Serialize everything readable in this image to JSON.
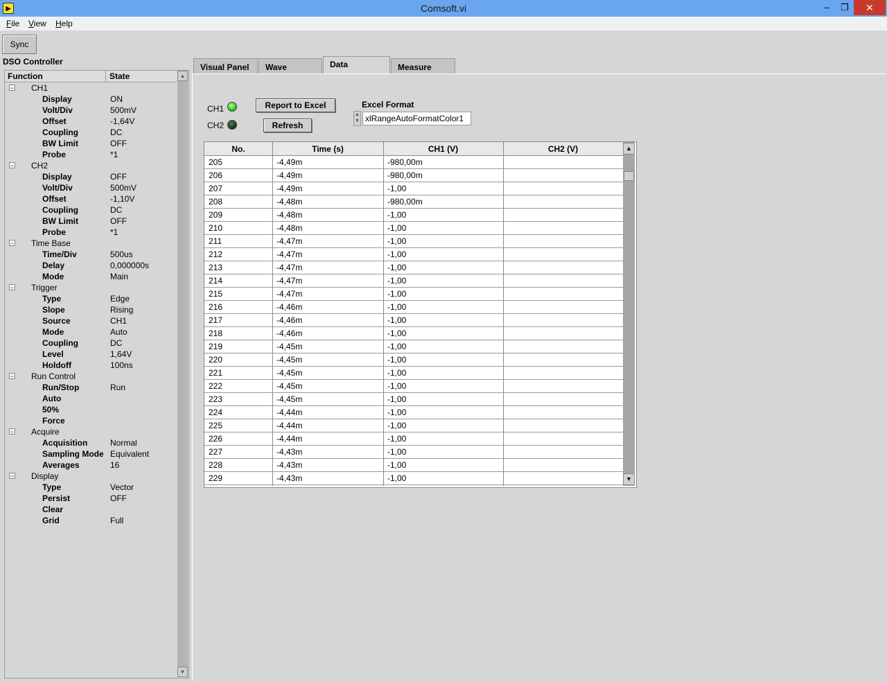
{
  "window": {
    "title": "Comsoft.vi",
    "min": "–",
    "max": "❐",
    "close": "✕"
  },
  "menu": [
    {
      "label": "File",
      "accel": "F",
      "rest": "ile"
    },
    {
      "label": "View",
      "accel": "V",
      "rest": "iew"
    },
    {
      "label": "Help",
      "accel": "H",
      "rest": "elp"
    }
  ],
  "toolbar": {
    "sync_label": "Sync"
  },
  "controller": {
    "title": "DSO Controller",
    "col_function": "Function",
    "col_state": "State",
    "groups": [
      {
        "label": "CH1",
        "children": [
          {
            "label": "Display",
            "value": "ON"
          },
          {
            "label": "Volt/Div",
            "value": "500mV"
          },
          {
            "label": "Offset",
            "value": "-1,64V"
          },
          {
            "label": "Coupling",
            "value": "DC"
          },
          {
            "label": "BW Limit",
            "value": "OFF"
          },
          {
            "label": "Probe",
            "value": "*1"
          }
        ]
      },
      {
        "label": "CH2",
        "children": [
          {
            "label": "Display",
            "value": "OFF"
          },
          {
            "label": "Volt/Div",
            "value": "500mV"
          },
          {
            "label": "Offset",
            "value": "-1,10V"
          },
          {
            "label": "Coupling",
            "value": "DC"
          },
          {
            "label": "BW Limit",
            "value": "OFF"
          },
          {
            "label": "Probe",
            "value": "*1"
          }
        ]
      },
      {
        "label": "Time Base",
        "children": [
          {
            "label": "Time/Div",
            "value": "500us"
          },
          {
            "label": "Delay",
            "value": "0,000000s"
          },
          {
            "label": "Mode",
            "value": "Main"
          }
        ]
      },
      {
        "label": "Trigger",
        "children": [
          {
            "label": "Type",
            "value": "Edge"
          },
          {
            "label": "Slope",
            "value": "Rising"
          },
          {
            "label": "Source",
            "value": "CH1"
          },
          {
            "label": "Mode",
            "value": "Auto"
          },
          {
            "label": "Coupling",
            "value": "DC"
          },
          {
            "label": "Level",
            "value": "1,64V"
          },
          {
            "label": "Holdoff",
            "value": "100ns"
          }
        ]
      },
      {
        "label": "Run Control",
        "children": [
          {
            "label": "Run/Stop",
            "value": "Run"
          },
          {
            "label": "Auto",
            "value": ""
          },
          {
            "label": "50%",
            "value": ""
          },
          {
            "label": "Force",
            "value": ""
          }
        ]
      },
      {
        "label": "Acquire",
        "children": [
          {
            "label": "Acquisition",
            "value": "Normal"
          },
          {
            "label": "Sampling Mode",
            "value": "Equivalent"
          },
          {
            "label": "Averages",
            "value": "16"
          }
        ]
      },
      {
        "label": "Display",
        "children": [
          {
            "label": "Type",
            "value": "Vector"
          },
          {
            "label": "Persist",
            "value": "OFF"
          },
          {
            "label": "Clear",
            "value": ""
          },
          {
            "label": "Grid",
            "value": "Full"
          }
        ]
      }
    ]
  },
  "tabs": [
    "Visual Panel",
    "Wave",
    "Data",
    "Measure"
  ],
  "active_tab": "Data",
  "data_panel": {
    "ch1_label": "CH1",
    "ch2_label": "CH2",
    "ch1_led_on": true,
    "ch2_led_on": false,
    "report_button": "Report to Excel",
    "refresh_button": "Refresh",
    "excel_format_label": "Excel Format",
    "excel_format_value": "xlRangeAutoFormatColor1",
    "led_on_color": "#2fd02f",
    "led_off_color": "#1f3a1f"
  },
  "table": {
    "headers": [
      "No.",
      "Time (s)",
      "CH1 (V)",
      "CH2 (V)"
    ],
    "rows": [
      [
        "205",
        "-4,49m",
        "-980,00m",
        ""
      ],
      [
        "206",
        "-4,49m",
        "-980,00m",
        ""
      ],
      [
        "207",
        "-4,49m",
        "-1,00",
        ""
      ],
      [
        "208",
        "-4,48m",
        "-980,00m",
        ""
      ],
      [
        "209",
        "-4,48m",
        "-1,00",
        ""
      ],
      [
        "210",
        "-4,48m",
        "-1,00",
        ""
      ],
      [
        "211",
        "-4,47m",
        "-1,00",
        ""
      ],
      [
        "212",
        "-4,47m",
        "-1,00",
        ""
      ],
      [
        "213",
        "-4,47m",
        "-1,00",
        ""
      ],
      [
        "214",
        "-4,47m",
        "-1,00",
        ""
      ],
      [
        "215",
        "-4,47m",
        "-1,00",
        ""
      ],
      [
        "216",
        "-4,46m",
        "-1,00",
        ""
      ],
      [
        "217",
        "-4,46m",
        "-1,00",
        ""
      ],
      [
        "218",
        "-4,46m",
        "-1,00",
        ""
      ],
      [
        "219",
        "-4,45m",
        "-1,00",
        ""
      ],
      [
        "220",
        "-4,45m",
        "-1,00",
        ""
      ],
      [
        "221",
        "-4,45m",
        "-1,00",
        ""
      ],
      [
        "222",
        "-4,45m",
        "-1,00",
        ""
      ],
      [
        "223",
        "-4,45m",
        "-1,00",
        ""
      ],
      [
        "224",
        "-4,44m",
        "-1,00",
        ""
      ],
      [
        "225",
        "-4,44m",
        "-1,00",
        ""
      ],
      [
        "226",
        "-4,44m",
        "-1,00",
        ""
      ],
      [
        "227",
        "-4,43m",
        "-1,00",
        ""
      ],
      [
        "228",
        "-4,43m",
        "-1,00",
        ""
      ],
      [
        "229",
        "-4,43m",
        "-1,00",
        ""
      ]
    ]
  }
}
